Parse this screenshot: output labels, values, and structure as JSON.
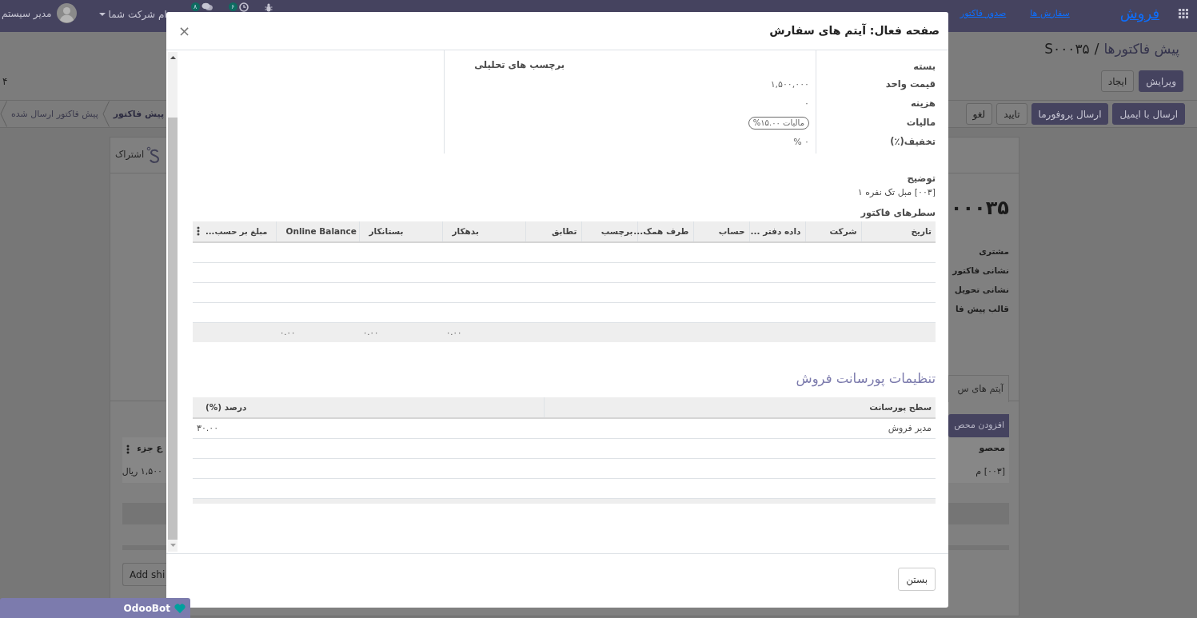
{
  "navbar": {
    "brand": "فروش",
    "menu": [
      "سفارش ها",
      "صدور فاکتور"
    ],
    "activities_counter": "۶",
    "messages_counter": "۸",
    "company": "ام شرکت شما",
    "user": "مدیر سیستم"
  },
  "control_panel": {
    "breadcrumbs": [
      {
        "label": "پیش فاکتورها",
        "selected": false
      },
      {
        "label": "S۰۰۰۳۵",
        "selected": true
      }
    ],
    "breadcrumb_separator": "/",
    "buttons": [
      {
        "label": "ویرایش",
        "kind": "primary"
      },
      {
        "label": "ایجاد",
        "kind": "secondary"
      }
    ],
    "pager": "۴"
  },
  "form_header": {
    "buttons": [
      {
        "label": "ارسال با ایمیل",
        "kind": "primary"
      },
      {
        "label": "ارسال پروفورما",
        "kind": "primary"
      },
      {
        "label": "تایید",
        "kind": "secondary"
      },
      {
        "label": "لغو",
        "kind": "secondary"
      }
    ],
    "states": [
      {
        "label": "پیش فاکتور",
        "selected": true
      },
      {
        "label": "پیش فاکتور ارسال شده",
        "selected": false
      }
    ]
  },
  "sheet": {
    "smart_button": "اشتراک",
    "title": "۰۰۰۳۵",
    "field_labels": [
      "مشتری",
      "نشانی فاکتور",
      "نشانی تحویل",
      "قالب پیش فا"
    ],
    "tabs": [
      {
        "label": "آیتم های س",
        "selected": true
      }
    ],
    "add_button": "افزودن محص",
    "lines": {
      "header_right": "محصو",
      "header_left": "ع جزء",
      "row_right": "[۰۰۳] م",
      "row_left": "۱,۵۰۰ ریال"
    },
    "add_shipping": "Add shi"
  },
  "modal": {
    "title": "صفحه فعال: آیتم های سفارش",
    "close": "×",
    "right_group": [
      {
        "label": "بسته"
      },
      {
        "label": "قیمت واحد",
        "value": "۱,۵۰۰,۰۰۰"
      },
      {
        "label": "هزینه",
        "value": "۰"
      },
      {
        "label": "مالیات",
        "tags": [
          "مالیات ۱۵.۰۰%"
        ]
      },
      {
        "label": "تخفیف(٪)",
        "value": "۰ %"
      }
    ],
    "left_group": [
      {
        "label": "برچسب های تحلیلی"
      }
    ],
    "description": {
      "label": "توضیح",
      "value": "[۰۰۳] مبل تک نفره ۱"
    },
    "invoice_lines": {
      "title": "سطرهای فاکتور",
      "columns": [
        {
          "label": "تاریخ",
          "kind": "text"
        },
        {
          "label": "شرکت",
          "kind": "text"
        },
        {
          "label": "داده دفتر ...",
          "kind": "text"
        },
        {
          "label": "حساب",
          "kind": "text"
        },
        {
          "label": "طرف همک...",
          "kind": "text"
        },
        {
          "label": "برچسب",
          "kind": "text"
        },
        {
          "label": "تطابق",
          "kind": "text"
        },
        {
          "label": "بدهکار",
          "kind": "number",
          "total": "۰.۰۰"
        },
        {
          "label": "بستانکار",
          "kind": "number",
          "total": "۰.۰۰"
        },
        {
          "label": "Online Balance",
          "kind": "number",
          "total": "۰.۰۰"
        },
        {
          "label": "مبلغ بر حسب...",
          "kind": "number"
        }
      ]
    },
    "commission": {
      "title": "تنظیمات پورسانت فروش",
      "columns": [
        {
          "label": "سطح پورسانت",
          "kind": "text"
        },
        {
          "label": "درصد (%)",
          "kind": "number"
        }
      ],
      "rows": [
        [
          "مدیر فروش",
          "۳۰.۰۰"
        ]
      ]
    },
    "footer_buttons": [
      "بستن"
    ]
  },
  "chat_window": {
    "title": "OdooBot"
  }
}
